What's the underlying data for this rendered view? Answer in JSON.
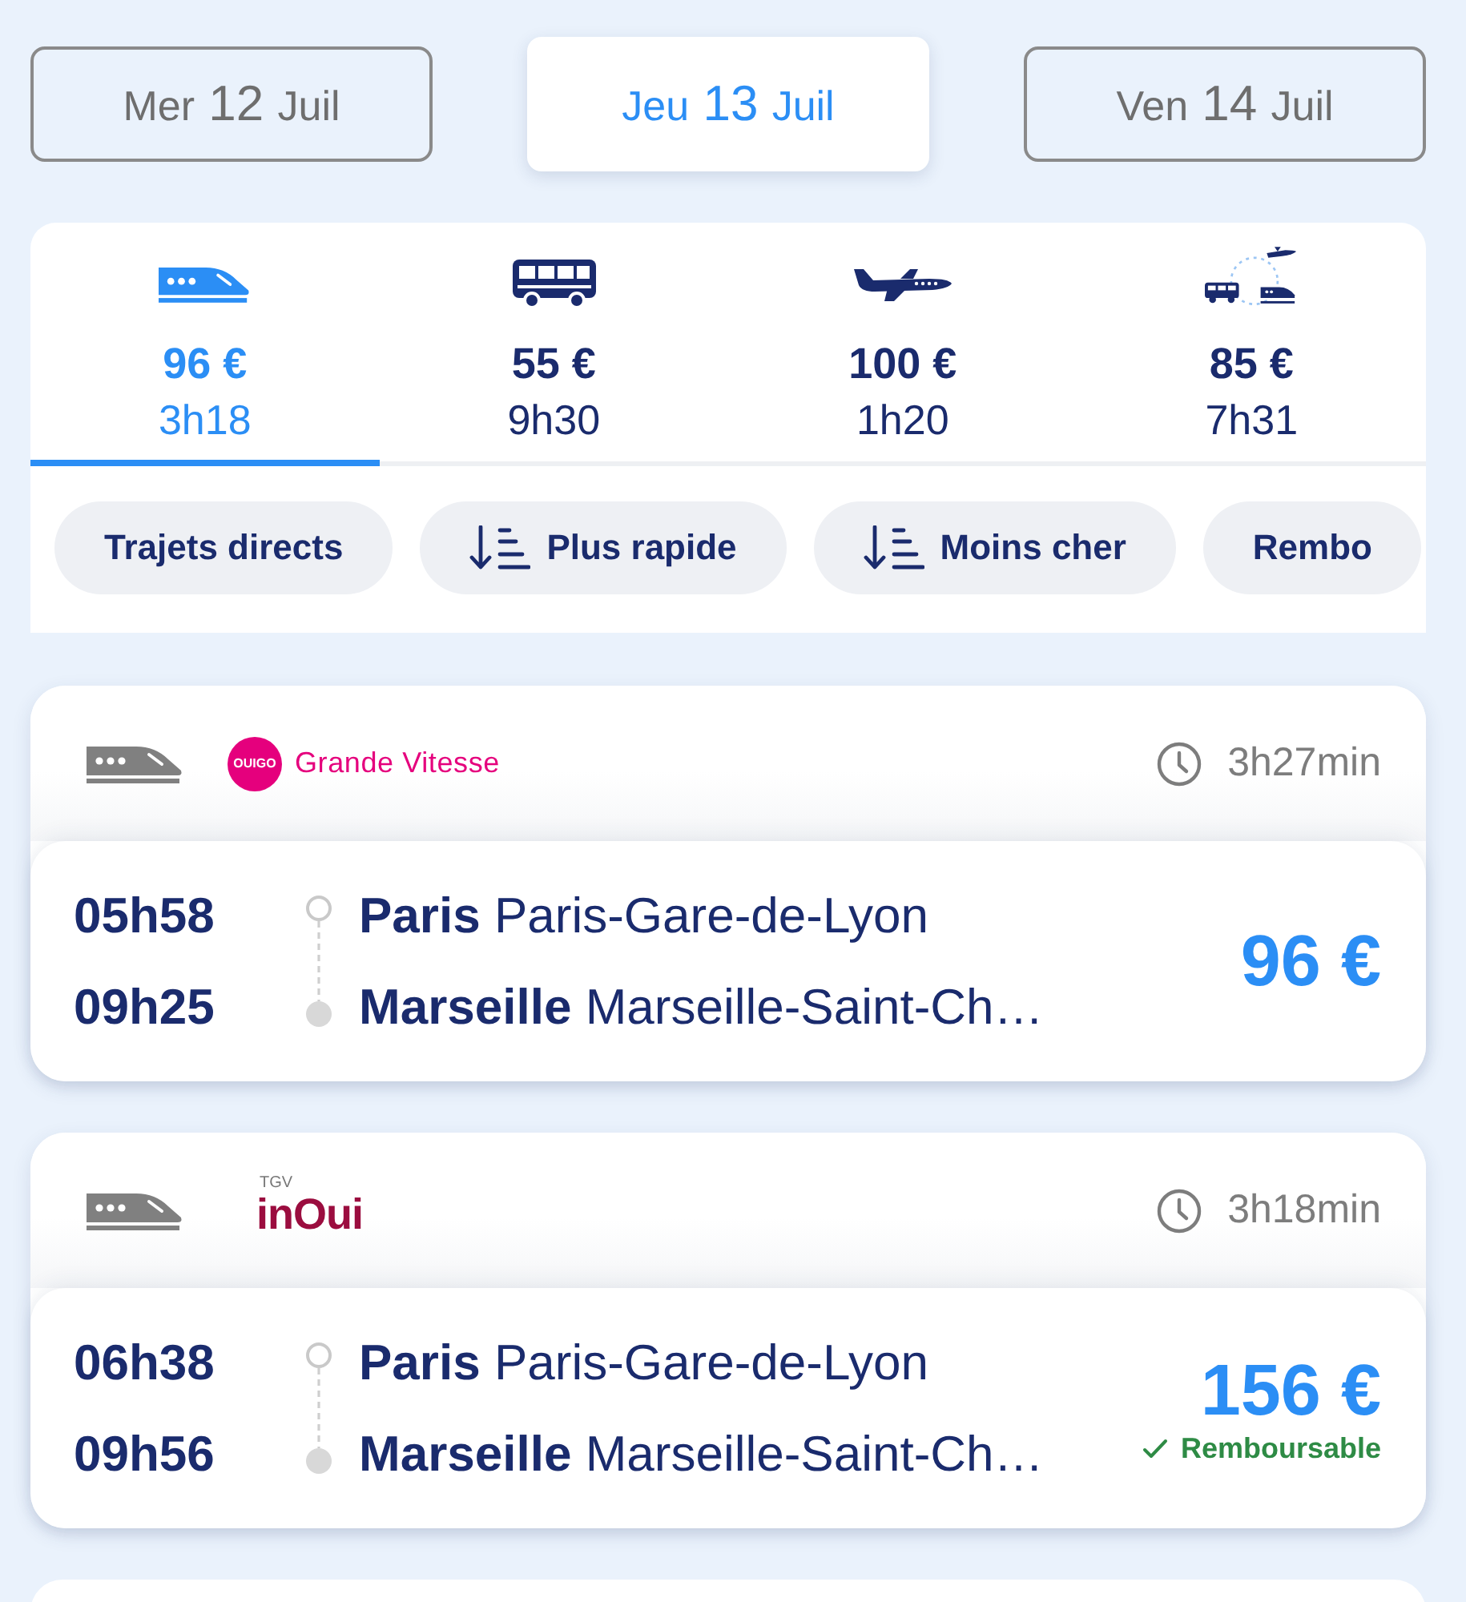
{
  "date_tabs": [
    {
      "weekday": "Mer",
      "day": "12",
      "month": "Juil",
      "selected": false
    },
    {
      "weekday": "Jeu",
      "day": "13",
      "month": "Juil",
      "selected": true
    },
    {
      "weekday": "Ven",
      "day": "14",
      "month": "Juil",
      "selected": false
    }
  ],
  "modes": [
    {
      "kind": "train",
      "price": "96 €",
      "duration": "3h18",
      "selected": true
    },
    {
      "kind": "bus",
      "price": "55 €",
      "duration": "9h30",
      "selected": false
    },
    {
      "kind": "plane",
      "price": "100 €",
      "duration": "1h20",
      "selected": false
    },
    {
      "kind": "multimodal",
      "price": "85 €",
      "duration": "7h31",
      "selected": false
    }
  ],
  "filters": [
    {
      "kind": "toggle",
      "label": "Trajets directs"
    },
    {
      "kind": "sort",
      "label": "Plus rapide"
    },
    {
      "kind": "sort",
      "label": "Moins cher"
    },
    {
      "kind": "toggle",
      "label": "Rembo"
    }
  ],
  "journeys": [
    {
      "operator": {
        "kind": "ouigo",
        "logo": "OUIGO",
        "service": "Grande Vitesse"
      },
      "duration": "3h27min",
      "departure": {
        "time": "05h58",
        "city": "Paris",
        "station": "Paris-Gare-de-Lyon"
      },
      "arrival": {
        "time": "09h25",
        "city": "Marseille",
        "station": "Marseille-Saint-Ch…"
      },
      "price": "96 €"
    },
    {
      "operator": {
        "kind": "inoui",
        "prefix": "TGV",
        "logo": "inOui"
      },
      "duration": "3h18min",
      "departure": {
        "time": "06h38",
        "city": "Paris",
        "station": "Paris-Gare-de-Lyon"
      },
      "arrival": {
        "time": "09h56",
        "city": "Marseille",
        "station": "Marseille-Saint-Ch…"
      },
      "price": "156 €",
      "refund": {
        "label": "Remboursable"
      }
    }
  ]
}
